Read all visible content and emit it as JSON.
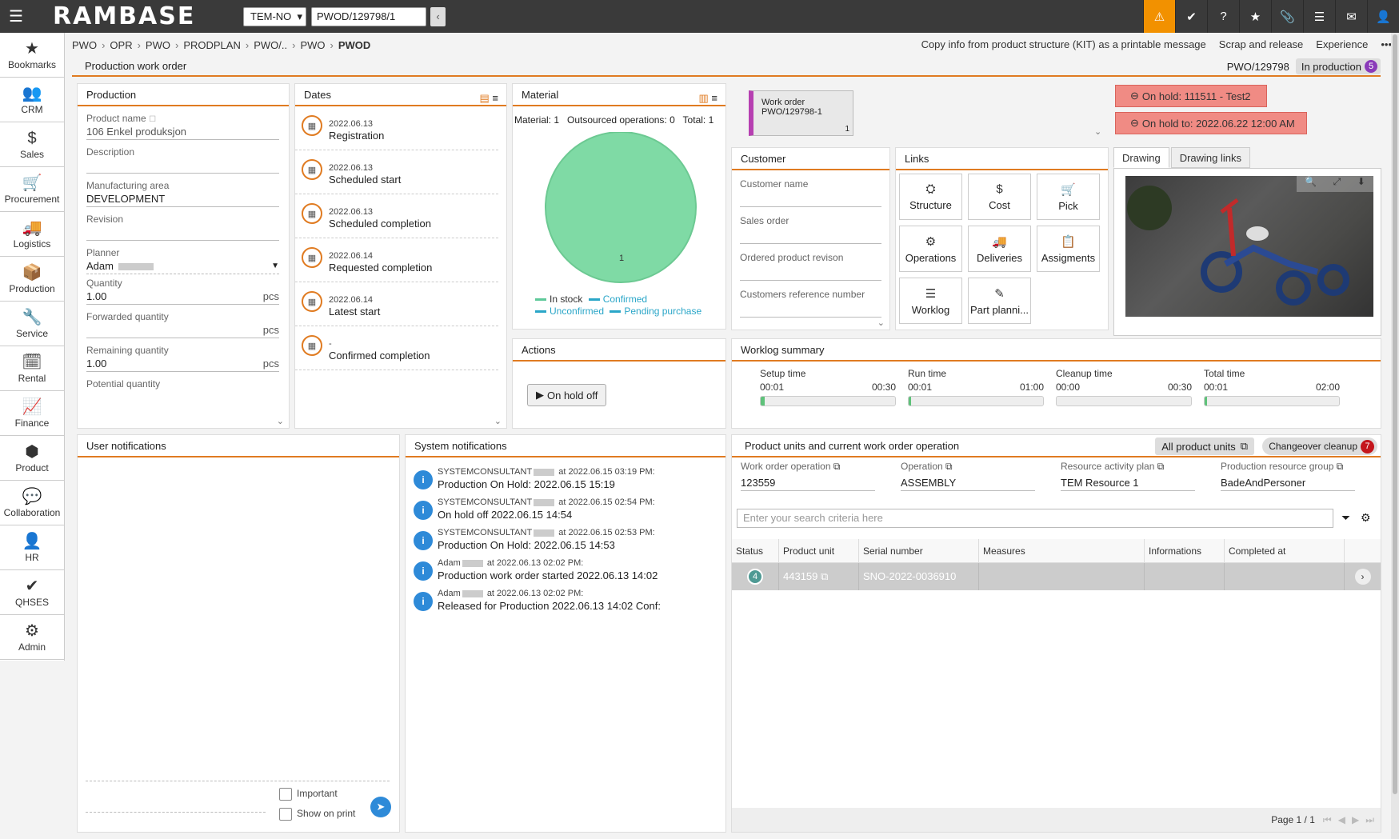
{
  "topbar": {
    "logo": "RAMBASE",
    "company": "TEM-NO",
    "document_id": "PWOD/129798/1",
    "back_icon": "‹",
    "icons": [
      "warning-icon",
      "check-badge-icon",
      "help-icon",
      "star-icon",
      "paperclip-icon",
      "list-icon",
      "mail-icon",
      "user-icon"
    ]
  },
  "sidebar": {
    "items": [
      {
        "label": "Bookmarks",
        "icon": "★"
      },
      {
        "label": "CRM",
        "icon": "👥"
      },
      {
        "label": "Sales",
        "icon": "$"
      },
      {
        "label": "Procurement",
        "icon": "🛒"
      },
      {
        "label": "Logistics",
        "icon": "🚚"
      },
      {
        "label": "Production",
        "icon": "📦"
      },
      {
        "label": "Service",
        "icon": "🔧"
      },
      {
        "label": "Rental",
        "icon": "🗓"
      },
      {
        "label": "Finance",
        "icon": "📈"
      },
      {
        "label": "Product",
        "icon": "⬢"
      },
      {
        "label": "Collaboration",
        "icon": "💬"
      },
      {
        "label": "HR",
        "icon": "👤"
      },
      {
        "label": "QHSES",
        "icon": "✔"
      },
      {
        "label": "Admin",
        "icon": "⚙"
      }
    ]
  },
  "breadcrumb": {
    "items": [
      "PWO",
      "OPR",
      "PWO",
      "PRODPLAN",
      "PWO/..",
      "PWO"
    ],
    "current": "PWOD",
    "actions": [
      "Copy info from product structure (KIT) as a printable message",
      "Scrap and release",
      "Experience",
      "•••"
    ]
  },
  "page": {
    "title": "Production work order",
    "doc_no": "PWO/129798",
    "status": "In production",
    "status_num": "5"
  },
  "production": {
    "title": "Production",
    "product_name_label": "Product name",
    "product_name": "106 Enkel produksjon",
    "description_label": "Description",
    "description": "",
    "area_label": "Manufacturing area",
    "area": "DEVELOPMENT",
    "revision_label": "Revision",
    "revision": "",
    "planner_label": "Planner",
    "planner": "Adam",
    "quantity_label": "Quantity",
    "quantity": "1.00",
    "forwarded_label": "Forwarded quantity",
    "forwarded": "",
    "remaining_label": "Remaining quantity",
    "remaining": "1.00",
    "potential_label": "Potential quantity",
    "unit": "pcs"
  },
  "dates": {
    "title": "Dates",
    "items": [
      {
        "date": "2022.06.13",
        "label": "Registration"
      },
      {
        "date": "2022.06.13",
        "label": "Scheduled start"
      },
      {
        "date": "2022.06.13",
        "label": "Scheduled completion"
      },
      {
        "date": "2022.06.14",
        "label": "Requested completion"
      },
      {
        "date": "2022.06.14",
        "label": "Latest start"
      },
      {
        "date": "-",
        "label": "Confirmed completion"
      }
    ]
  },
  "material": {
    "title": "Material",
    "summary": "Material: 1   Outsourced operations: 0   Total: 1",
    "slice_label": "1",
    "legend": [
      {
        "label": "In stock",
        "color": "#5ec99a"
      },
      {
        "label": "Confirmed",
        "color": "#2aa6c8"
      },
      {
        "label": "Unconfirmed",
        "color": "#2aa6c8"
      },
      {
        "label": "Pending purchase",
        "color": "#2aa6c8"
      }
    ],
    "pie_color": "#7fdaa5"
  },
  "workorder_card": {
    "line1": "Work order",
    "line2": "PWO/129798-1",
    "count": "1"
  },
  "holds": {
    "hold1": "On hold: 111511 - Test2",
    "hold2": "On hold to: 2022.06.22 12:00 AM"
  },
  "customer": {
    "title": "Customer",
    "fields": [
      "Customer name",
      "Sales order",
      "Ordered product revison",
      "Customers reference number"
    ]
  },
  "links": {
    "title": "Links",
    "tiles": [
      {
        "label": "Structure",
        "icon": "⛭"
      },
      {
        "label": "Cost",
        "icon": "$"
      },
      {
        "label": "Pick",
        "icon": "🛒"
      },
      {
        "label": "Operations",
        "icon": "⚙"
      },
      {
        "label": "Deliveries",
        "icon": "🚚"
      },
      {
        "label": "Assigments",
        "icon": "📋"
      },
      {
        "label": "Worklog",
        "icon": "☰"
      },
      {
        "label": "Part planni...",
        "icon": "✎"
      }
    ]
  },
  "drawing": {
    "tabs": [
      "Drawing",
      "Drawing links"
    ]
  },
  "actions": {
    "title": "Actions",
    "onhold_off": "On hold off"
  },
  "worklog": {
    "title": "Worklog summary",
    "cols": [
      {
        "title": "Setup time",
        "used": "00:01",
        "planned": "00:30",
        "fill": 0.03
      },
      {
        "title": "Run time",
        "used": "00:01",
        "planned": "01:00",
        "fill": 0.02
      },
      {
        "title": "Cleanup time",
        "used": "00:00",
        "planned": "00:30",
        "fill": 0
      },
      {
        "title": "Total time",
        "used": "00:01",
        "planned": "02:00",
        "fill": 0.02
      }
    ]
  },
  "user_notifications": {
    "title": "User notifications",
    "important": "Important",
    "show_on_print": "Show on print"
  },
  "system_notifications": {
    "title": "System notifications",
    "items": [
      {
        "who": "SYSTEMCONSULTANT",
        "when": "at 2022.06.15 03:19 PM:",
        "text": "Production On Hold: 2022.06.15 15:19"
      },
      {
        "who": "SYSTEMCONSULTANT",
        "when": "at 2022.06.15 02:54 PM:",
        "text": "On hold off 2022.06.15 14:54"
      },
      {
        "who": "SYSTEMCONSULTANT",
        "when": "at 2022.06.15 02:53 PM:",
        "text": "Production On Hold: 2022.06.15 14:53"
      },
      {
        "who": "Adam",
        "when": "at 2022.06.13 02:02 PM:",
        "text": "Production work order started 2022.06.13 14:02"
      },
      {
        "who": "Adam",
        "when": "at 2022.06.13 02:02 PM:",
        "text": "Released for Production 2022.06.13 14:02 Conf:"
      }
    ]
  },
  "product_units": {
    "title": "Product units and current work order operation",
    "all_units": "All product units",
    "changeover": "Changeover cleanup",
    "changeover_num": "7",
    "fields": [
      {
        "label": "Work order operation",
        "value": "123559"
      },
      {
        "label": "Operation",
        "value": "ASSEMBLY"
      },
      {
        "label": "Resource activity plan",
        "value": "TEM Resource 1"
      },
      {
        "label": "Production resource group",
        "value": "BadeAndPersoner"
      }
    ],
    "search_placeholder": "Enter your search criteria here",
    "columns": [
      "Status",
      "Product unit",
      "Serial number",
      "Measures",
      "Informations",
      "Completed at"
    ],
    "row": {
      "status": "4",
      "unit": "443159",
      "serial": "SNO-2022-0036910",
      "measures": "",
      "info": "",
      "completed": ""
    },
    "pager": "Page 1 / 1"
  }
}
